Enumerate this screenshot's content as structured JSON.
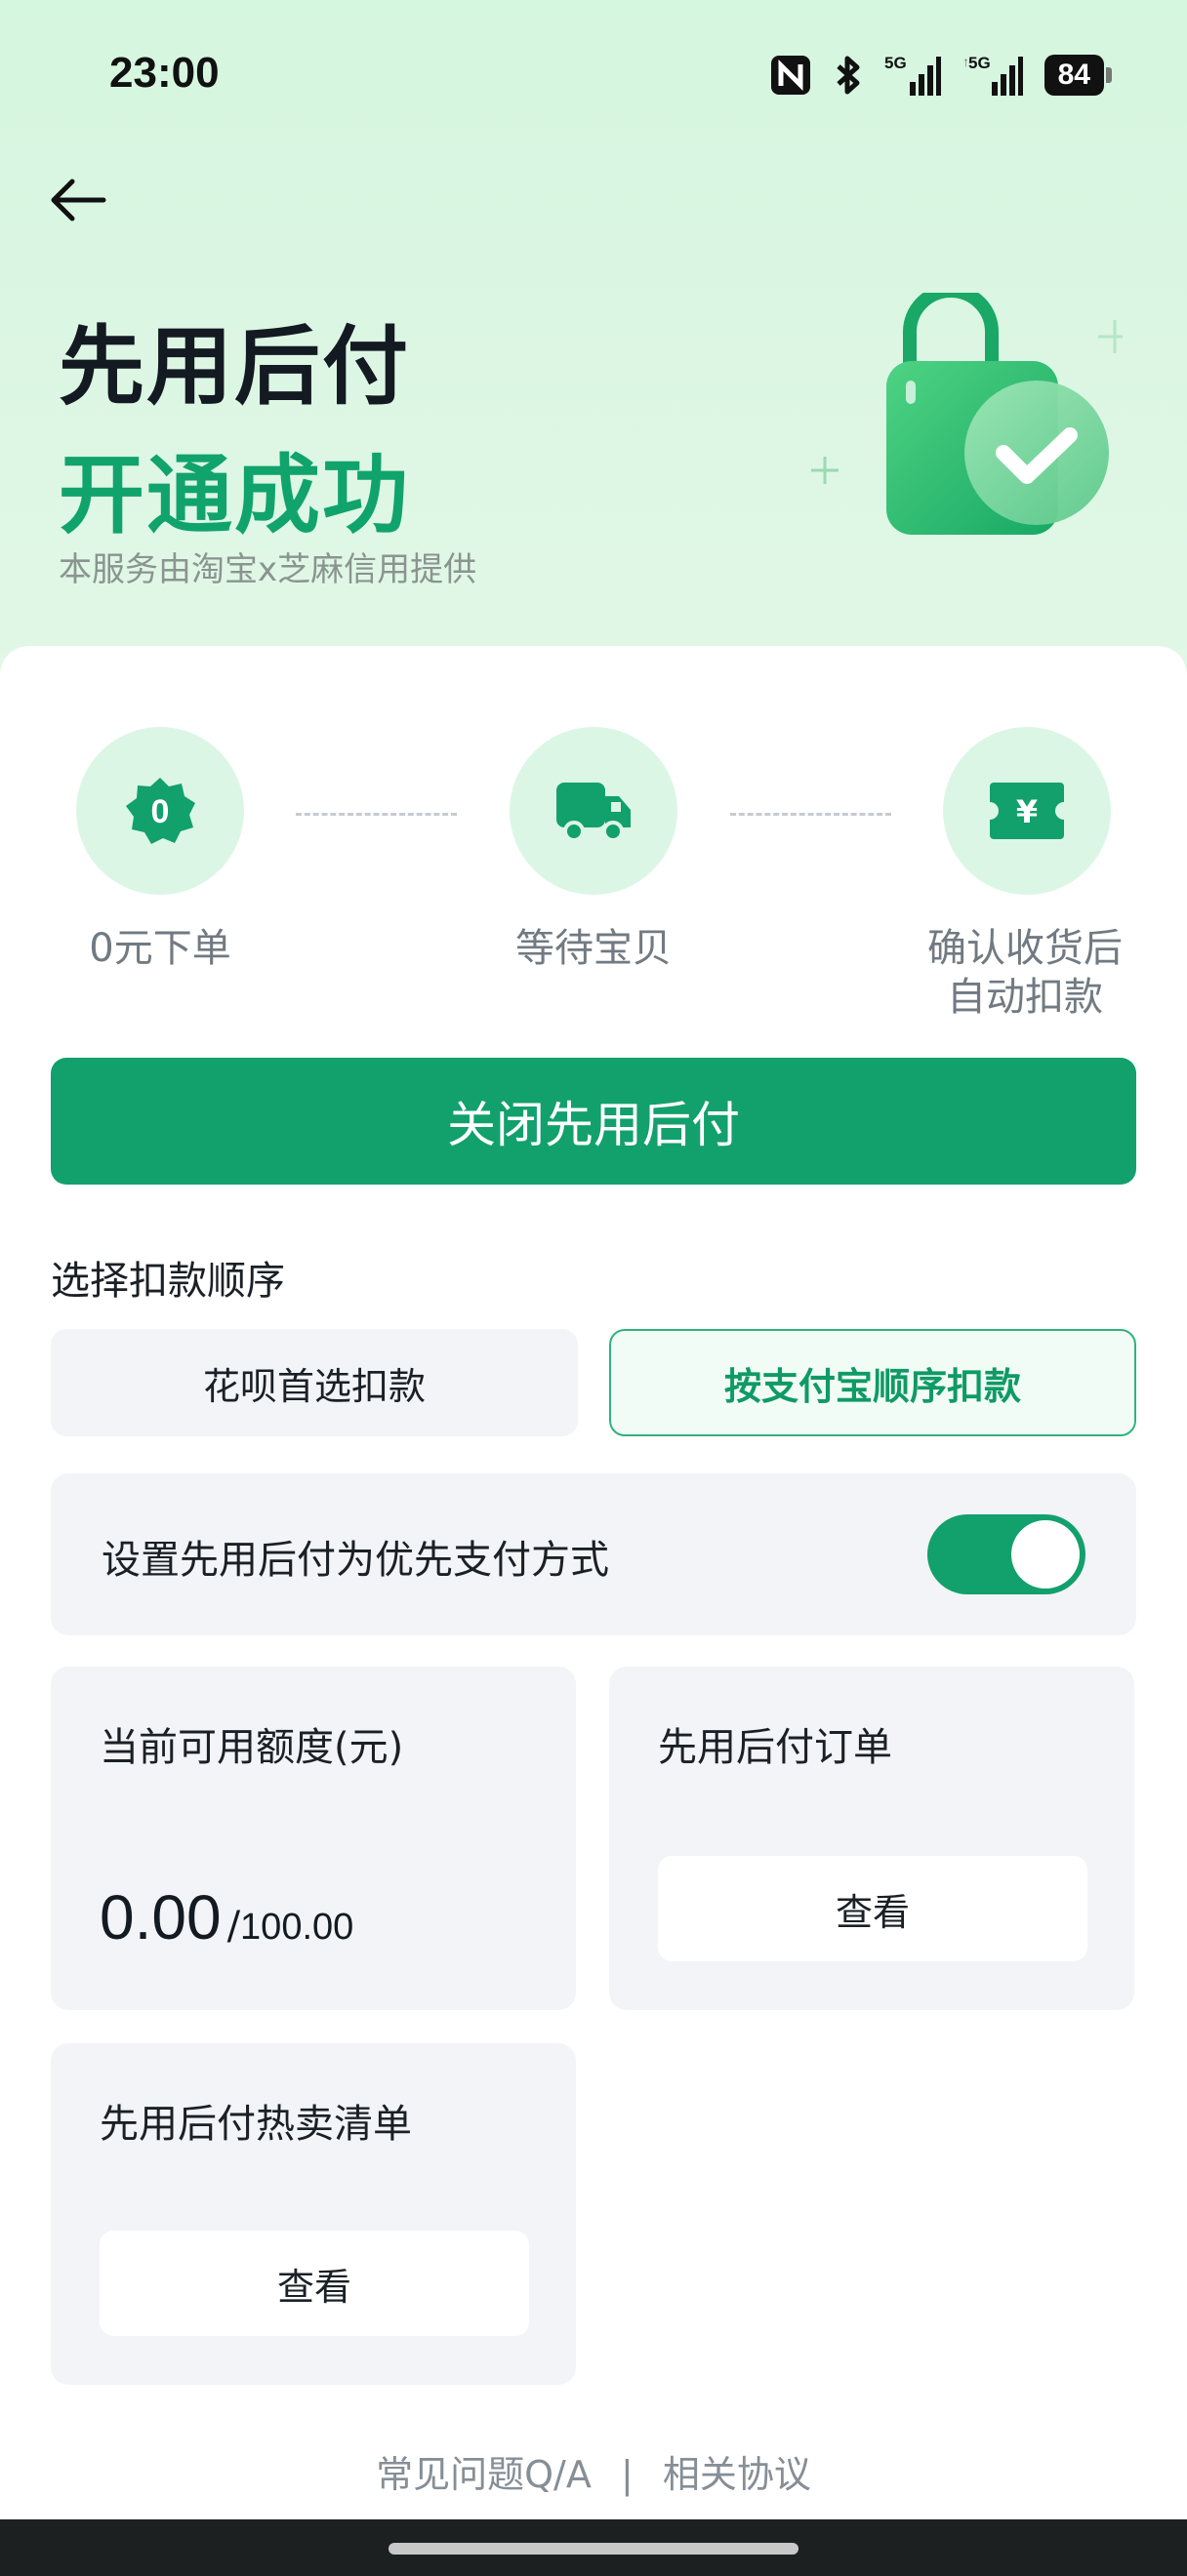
{
  "status_bar": {
    "time": "23:00",
    "battery": "84",
    "icons": [
      "nfc-icon",
      "bluetooth-icon",
      "signal-5g-icon",
      "signal-5g-icon"
    ]
  },
  "header": {
    "back_icon": "arrow-left-icon",
    "title_line1": "先用后付",
    "title_line2": "开通成功",
    "subtitle": "本服务由淘宝x芝麻信用提供",
    "illustration": "shopping-bag-check-icon"
  },
  "steps": [
    {
      "icon": "zero-badge-icon",
      "icon_text": "0",
      "label": "0元下单"
    },
    {
      "icon": "truck-icon",
      "label": "等待宝贝"
    },
    {
      "icon": "yuan-ticket-icon",
      "icon_text": "¥",
      "label_line1": "确认收货后",
      "label_line2": "自动扣款"
    }
  ],
  "close_button": "关闭先用后付",
  "deduction": {
    "title": "选择扣款顺序",
    "options": [
      {
        "label": "花呗首选扣款",
        "selected": false
      },
      {
        "label": "按支付宝顺序扣款",
        "selected": true
      }
    ]
  },
  "preference": {
    "label": "设置先用后付为优先支付方式",
    "enabled": true
  },
  "credit": {
    "title": "当前可用额度(元)",
    "available": "0.00",
    "separator": "/",
    "total": "100.00"
  },
  "orders": {
    "title": "先用后付订单",
    "button": "查看"
  },
  "hot_list": {
    "title": "先用后付热卖清单",
    "button": "查看"
  },
  "footer": {
    "faq": "常见问题Q/A",
    "divider": "|",
    "agreement": "相关协议"
  },
  "colors": {
    "accent": "#12a06c",
    "hero_bg": "#d5f6df",
    "step_circle": "#dcf6e6",
    "tile_bg": "#f2f4f7"
  }
}
